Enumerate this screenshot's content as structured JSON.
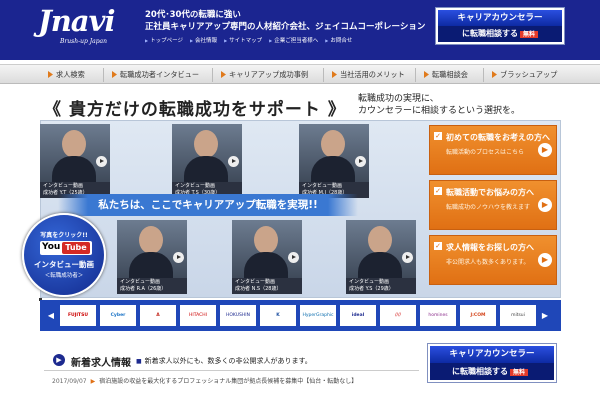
{
  "header": {
    "logo_text": "Jnavi",
    "logo_sub": "Brush-up Japan",
    "tagline_1": "20代･30代の転職に強い",
    "tagline_2": "正社員キャリアアップ専門の人材紹介会社、ジェイコムコーポレーション",
    "top_links": [
      "トップページ",
      "会社情報",
      "サイトマップ",
      "企業ご担当者様へ",
      "お問合せ"
    ],
    "cta": {
      "title": "キャリアカウンセラー",
      "sub": "に転職相談する",
      "badge": "無料"
    }
  },
  "nav": {
    "items": [
      "求人検索",
      "転職成功者インタビュー",
      "キャリアアップ成功事例",
      "当社活用のメリット",
      "転職相談会",
      "ブラッシュアップ"
    ]
  },
  "hero": {
    "title": "《 貴方だけの転職成功をサポート 》",
    "sub_line1": "転職成功の実現に、",
    "sub_line2": "カウンセラーに相談するという選択を。"
  },
  "interviews": [
    {
      "label": "インタビュー動画",
      "name": "成功者 Y.T（25歳）"
    },
    {
      "label": "インタビュー動画",
      "name": "成功者 T.S（30歳）"
    },
    {
      "label": "インタビュー動画",
      "name": "成功者 M.I（28歳）"
    },
    {
      "label": "インタビュー動画",
      "name": "成功者 R.A（26歳）"
    },
    {
      "label": "インタビュー動画",
      "name": "成功者 N.S（28歳）"
    },
    {
      "label": "インタビュー動画",
      "name": "成功者 Y.S（29歳）"
    }
  ],
  "banner": "私たちは、ここでキャリアアップ転職を実現!!",
  "youtube": {
    "click": "写真をクリック!!",
    "you": "You",
    "tube": "Tube",
    "title": "インタビュー動画",
    "sub": "＜転職成功者＞"
  },
  "side_panels": [
    {
      "title": "初めての転職をお考えの方へ",
      "sub": "転職活動のプロセスはこちら"
    },
    {
      "title": "転職活動でお悩みの方へ",
      "sub": "転職成功のノウハウを教えます"
    },
    {
      "title": "求人情報をお探しの方へ",
      "sub": "非公開求人も数多くあります。"
    }
  ],
  "companies": [
    "FUJITSU",
    "Cyber",
    "A",
    "HITACHI",
    "HOKUSHIN",
    "K",
    "HyperGraphic",
    "ideal",
    "////",
    "homines",
    "J:COM",
    "mitsui"
  ],
  "news": {
    "title": "新着求人情報",
    "subtitle": "新着求人以外にも、数多くの非公開求人があります。",
    "date": "2017/09/07",
    "text": "宿泊施設の収益を最大化するプロフェッショナル集団が拠点長候補を募集中【仙台・転勤なし】"
  },
  "cta2": {
    "title": "キャリアカウンセラー",
    "sub": "に転職相談する",
    "badge": "無料"
  }
}
